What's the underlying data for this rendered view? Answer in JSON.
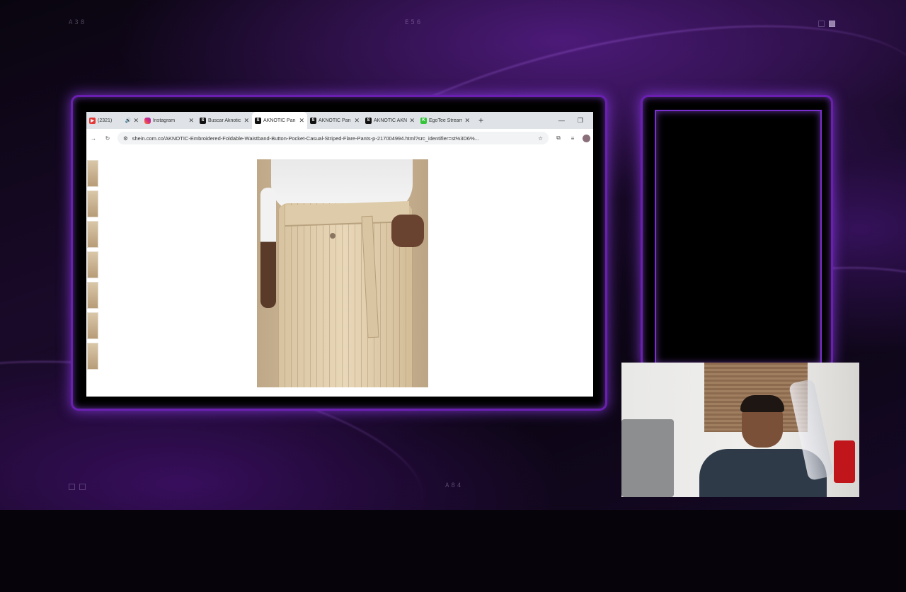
{
  "hud": {
    "top_left": "A38",
    "top_center": "E56",
    "bottom_center": "A84"
  },
  "tabs": [
    {
      "icon": "youtube",
      "title": "(2321) ",
      "extra": "🕪",
      "active": false
    },
    {
      "icon": "instagram",
      "title": "Instagram",
      "active": false
    },
    {
      "icon": "shein",
      "title": "Buscar Aknotic",
      "active": false
    },
    {
      "icon": "shein",
      "title": "AKNOTIC Pan",
      "active": true
    },
    {
      "icon": "shein",
      "title": "AKNOTIC Pan",
      "active": false
    },
    {
      "icon": "shein",
      "title": "AKNOTIC AKN",
      "active": false
    },
    {
      "icon": "egotee",
      "title": "EgoTee Stream",
      "active": false
    }
  ],
  "address_bar": {
    "url": "shein.com.co/AKNOTIC-Embroidered-Foldable-Waistband-Button-Pocket-Casual-Striped-Flare-Pants-p-217004994.html?src_identifier=st%3D6%..."
  },
  "colors": {
    "frame_glow": "#6a1fb0",
    "background": "#06040a",
    "page": "#ffffff"
  }
}
